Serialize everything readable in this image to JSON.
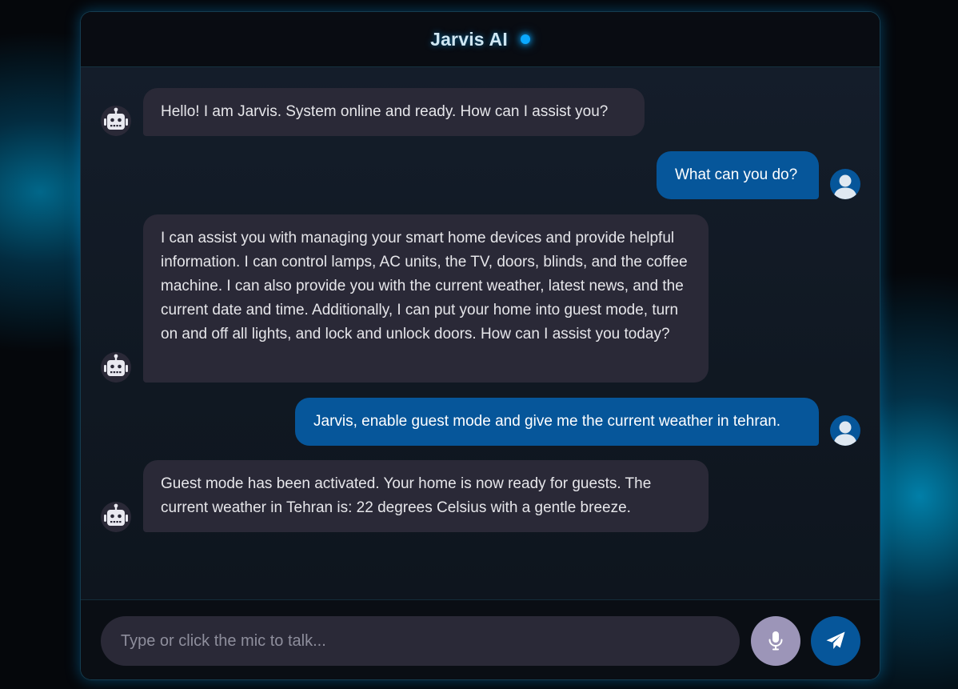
{
  "app": {
    "title": "Jarvis AI",
    "status_color": "#0aa8ff"
  },
  "colors": {
    "bot_bubble": "#2a2937",
    "user_bubble": "#06569a",
    "accent": "#0aa8ff"
  },
  "messages": [
    {
      "sender": "bot",
      "avatar_icon": "robot-icon",
      "text": "Hello! I am Jarvis. System online and ready. How can I assist you?"
    },
    {
      "sender": "user",
      "avatar_icon": "user-icon",
      "text": "What can you do?"
    },
    {
      "sender": "bot",
      "avatar_icon": "robot-icon",
      "text": "I can assist you with managing your smart home devices and provide helpful information. I can control lamps, AC units, the TV, doors, blinds, and the coffee machine. I can also provide you with the current weather, latest news, and the current date and time. Additionally, I can put your home into guest mode, turn on and off all lights, and lock and unlock doors. How can I assist you today?"
    },
    {
      "sender": "user",
      "avatar_icon": "user-icon",
      "text": "Jarvis, enable guest mode and give me the current weather in tehran."
    },
    {
      "sender": "bot",
      "avatar_icon": "robot-icon",
      "text": "Guest mode has been activated. Your home is now ready for guests. The current weather in Tehran is: 22 degrees Celsius with a gentle breeze."
    }
  ],
  "composer": {
    "placeholder": "Type or click the mic to talk...",
    "value": "",
    "mic_icon": "microphone-icon",
    "send_icon": "paper-plane-icon"
  }
}
